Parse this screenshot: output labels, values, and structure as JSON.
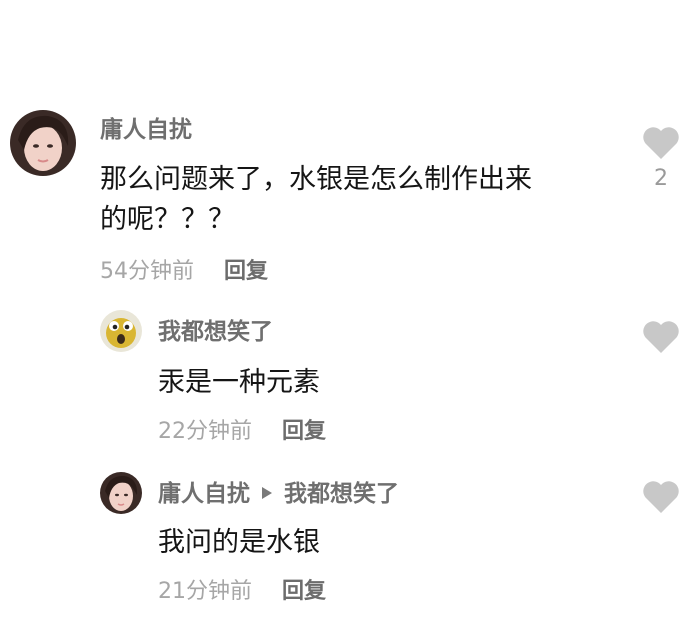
{
  "comments": [
    {
      "username": "庸人自扰",
      "content_lines": [
        "那么问题来了，水银是怎么制作出来",
        "的呢？？？"
      ],
      "time": "54分钟前",
      "reply_label": "回复",
      "like_count": "2",
      "avatar_icon": "girl-avatar-icon"
    },
    {
      "username": "我都想笑了",
      "content_lines": [
        "汞是一种元素"
      ],
      "time": "22分钟前",
      "reply_label": "回复",
      "like_count": "",
      "avatar_icon": "cartoon-avatar-icon"
    },
    {
      "username": "庸人自扰",
      "reply_to": "我都想笑了",
      "content_lines": [
        "我问的是水银"
      ],
      "time": "21分钟前",
      "reply_label": "回复",
      "like_count": "",
      "avatar_icon": "girl-avatar-icon"
    }
  ],
  "colors": {
    "username": "#6f6f6f",
    "content": "#151515",
    "meta": "#a6a6a6",
    "heart": "#c8c8c8"
  }
}
